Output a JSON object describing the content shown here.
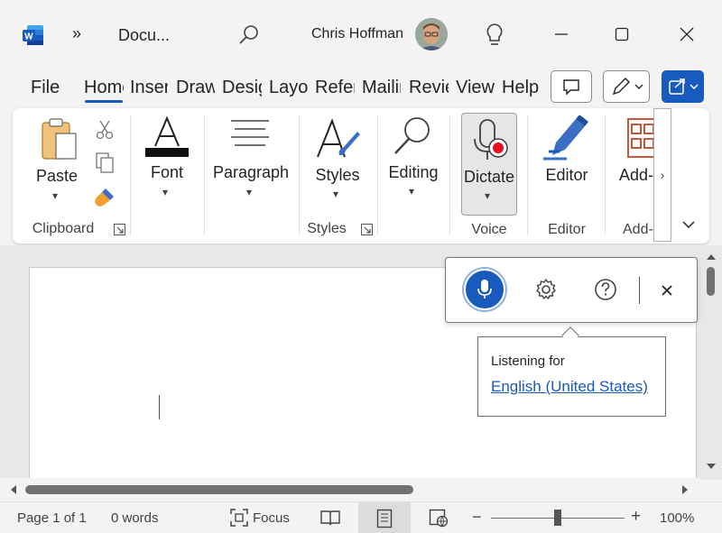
{
  "titlebar": {
    "app_icon": "word-icon",
    "more_label": "»",
    "doc_title": "Docu...",
    "user_name": "Chris Hoffman"
  },
  "tabs": [
    {
      "label": "File"
    },
    {
      "label": "Home"
    },
    {
      "label": "Insert"
    },
    {
      "label": "Draw"
    },
    {
      "label": "Design"
    },
    {
      "label": "Layout"
    },
    {
      "label": "References"
    },
    {
      "label": "Mailings"
    },
    {
      "label": "Review"
    },
    {
      "label": "View"
    },
    {
      "label": "Help"
    }
  ],
  "ribbon": {
    "paste": "Paste",
    "clipboard_group": "Clipboard",
    "font": "Font",
    "paragraph": "Paragraph",
    "styles": "Styles",
    "styles_group": "Styles",
    "editing": "Editing",
    "dictate": "Dictate",
    "voice_group": "Voice",
    "editor": "Editor",
    "editor_group": "Editor",
    "addins": "Add-",
    "addins_group": "Add-"
  },
  "dictation": {
    "listening_label": "Listening for",
    "language": "English (United States)"
  },
  "status": {
    "page": "Page 1 of 1",
    "words": "0 words",
    "focus": "Focus",
    "zoom": "100%",
    "zoom_minus": "−",
    "zoom_plus": "+"
  },
  "colors": {
    "accent": "#185abd",
    "mic_blue": "#185abd",
    "record_red": "#e81123"
  }
}
